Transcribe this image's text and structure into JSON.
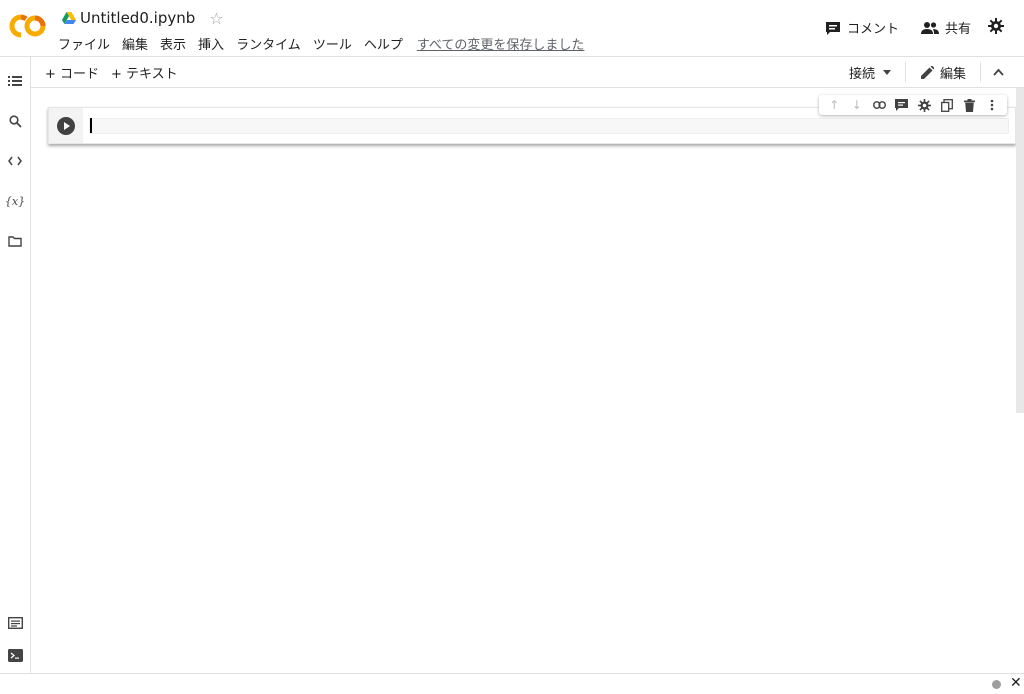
{
  "header": {
    "notebook_title": "Untitled0.ipynb",
    "menu": [
      "ファイル",
      "編集",
      "表示",
      "挿入",
      "ランタイム",
      "ツール",
      "ヘルプ"
    ],
    "save_status": "すべての変更を保存しました",
    "comment_label": "コメント",
    "share_label": "共有"
  },
  "toolbar": {
    "add_code_label": "+ コード",
    "add_text_label": "+ テキスト",
    "connect_label": "接続",
    "edit_label": "編集"
  },
  "rail": {
    "icons": [
      "toc-icon",
      "search-icon",
      "code-snippets-icon",
      "variables-icon",
      "files-icon",
      "command-palette-icon",
      "terminal-icon"
    ],
    "variables_glyph": "{x}"
  },
  "cell": {
    "content": ""
  },
  "colors": {
    "logo_orange": "#F9AB00",
    "logo_dark_orange": "#E8710A",
    "drive_green": "#0F9D58",
    "drive_blue": "#4285F4",
    "drive_yellow": "#FBBC04"
  }
}
